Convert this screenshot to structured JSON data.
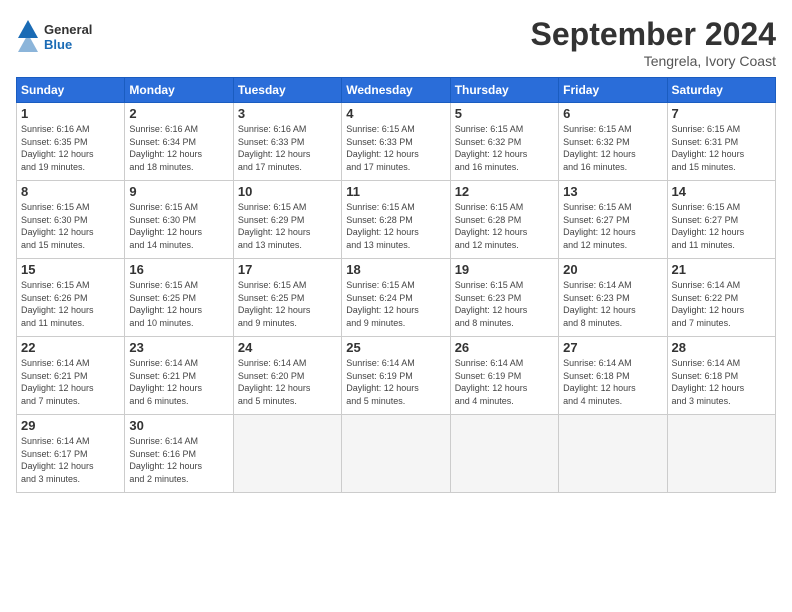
{
  "logo": {
    "line1": "General",
    "line2": "Blue"
  },
  "title": "September 2024",
  "location": "Tengrela, Ivory Coast",
  "weekdays": [
    "Sunday",
    "Monday",
    "Tuesday",
    "Wednesday",
    "Thursday",
    "Friday",
    "Saturday"
  ],
  "days": [
    {
      "num": "",
      "info": ""
    },
    {
      "num": "",
      "info": ""
    },
    {
      "num": "",
      "info": ""
    },
    {
      "num": "",
      "info": ""
    },
    {
      "num": "",
      "info": ""
    },
    {
      "num": "",
      "info": ""
    },
    {
      "num": "",
      "info": ""
    },
    {
      "num": "1",
      "info": "Sunrise: 6:16 AM\nSunset: 6:35 PM\nDaylight: 12 hours\nand 19 minutes."
    },
    {
      "num": "2",
      "info": "Sunrise: 6:16 AM\nSunset: 6:34 PM\nDaylight: 12 hours\nand 18 minutes."
    },
    {
      "num": "3",
      "info": "Sunrise: 6:16 AM\nSunset: 6:33 PM\nDaylight: 12 hours\nand 17 minutes."
    },
    {
      "num": "4",
      "info": "Sunrise: 6:15 AM\nSunset: 6:33 PM\nDaylight: 12 hours\nand 17 minutes."
    },
    {
      "num": "5",
      "info": "Sunrise: 6:15 AM\nSunset: 6:32 PM\nDaylight: 12 hours\nand 16 minutes."
    },
    {
      "num": "6",
      "info": "Sunrise: 6:15 AM\nSunset: 6:32 PM\nDaylight: 12 hours\nand 16 minutes."
    },
    {
      "num": "7",
      "info": "Sunrise: 6:15 AM\nSunset: 6:31 PM\nDaylight: 12 hours\nand 15 minutes."
    },
    {
      "num": "8",
      "info": "Sunrise: 6:15 AM\nSunset: 6:30 PM\nDaylight: 12 hours\nand 15 minutes."
    },
    {
      "num": "9",
      "info": "Sunrise: 6:15 AM\nSunset: 6:30 PM\nDaylight: 12 hours\nand 14 minutes."
    },
    {
      "num": "10",
      "info": "Sunrise: 6:15 AM\nSunset: 6:29 PM\nDaylight: 12 hours\nand 13 minutes."
    },
    {
      "num": "11",
      "info": "Sunrise: 6:15 AM\nSunset: 6:28 PM\nDaylight: 12 hours\nand 13 minutes."
    },
    {
      "num": "12",
      "info": "Sunrise: 6:15 AM\nSunset: 6:28 PM\nDaylight: 12 hours\nand 12 minutes."
    },
    {
      "num": "13",
      "info": "Sunrise: 6:15 AM\nSunset: 6:27 PM\nDaylight: 12 hours\nand 12 minutes."
    },
    {
      "num": "14",
      "info": "Sunrise: 6:15 AM\nSunset: 6:27 PM\nDaylight: 12 hours\nand 11 minutes."
    },
    {
      "num": "15",
      "info": "Sunrise: 6:15 AM\nSunset: 6:26 PM\nDaylight: 12 hours\nand 11 minutes."
    },
    {
      "num": "16",
      "info": "Sunrise: 6:15 AM\nSunset: 6:25 PM\nDaylight: 12 hours\nand 10 minutes."
    },
    {
      "num": "17",
      "info": "Sunrise: 6:15 AM\nSunset: 6:25 PM\nDaylight: 12 hours\nand 9 minutes."
    },
    {
      "num": "18",
      "info": "Sunrise: 6:15 AM\nSunset: 6:24 PM\nDaylight: 12 hours\nand 9 minutes."
    },
    {
      "num": "19",
      "info": "Sunrise: 6:15 AM\nSunset: 6:23 PM\nDaylight: 12 hours\nand 8 minutes."
    },
    {
      "num": "20",
      "info": "Sunrise: 6:14 AM\nSunset: 6:23 PM\nDaylight: 12 hours\nand 8 minutes."
    },
    {
      "num": "21",
      "info": "Sunrise: 6:14 AM\nSunset: 6:22 PM\nDaylight: 12 hours\nand 7 minutes."
    },
    {
      "num": "22",
      "info": "Sunrise: 6:14 AM\nSunset: 6:21 PM\nDaylight: 12 hours\nand 7 minutes."
    },
    {
      "num": "23",
      "info": "Sunrise: 6:14 AM\nSunset: 6:21 PM\nDaylight: 12 hours\nand 6 minutes."
    },
    {
      "num": "24",
      "info": "Sunrise: 6:14 AM\nSunset: 6:20 PM\nDaylight: 12 hours\nand 5 minutes."
    },
    {
      "num": "25",
      "info": "Sunrise: 6:14 AM\nSunset: 6:19 PM\nDaylight: 12 hours\nand 5 minutes."
    },
    {
      "num": "26",
      "info": "Sunrise: 6:14 AM\nSunset: 6:19 PM\nDaylight: 12 hours\nand 4 minutes."
    },
    {
      "num": "27",
      "info": "Sunrise: 6:14 AM\nSunset: 6:18 PM\nDaylight: 12 hours\nand 4 minutes."
    },
    {
      "num": "28",
      "info": "Sunrise: 6:14 AM\nSunset: 6:18 PM\nDaylight: 12 hours\nand 3 minutes."
    },
    {
      "num": "29",
      "info": "Sunrise: 6:14 AM\nSunset: 6:17 PM\nDaylight: 12 hours\nand 3 minutes."
    },
    {
      "num": "30",
      "info": "Sunrise: 6:14 AM\nSunset: 6:16 PM\nDaylight: 12 hours\nand 2 minutes."
    },
    {
      "num": "",
      "info": ""
    },
    {
      "num": "",
      "info": ""
    },
    {
      "num": "",
      "info": ""
    },
    {
      "num": "",
      "info": ""
    },
    {
      "num": "",
      "info": ""
    }
  ]
}
